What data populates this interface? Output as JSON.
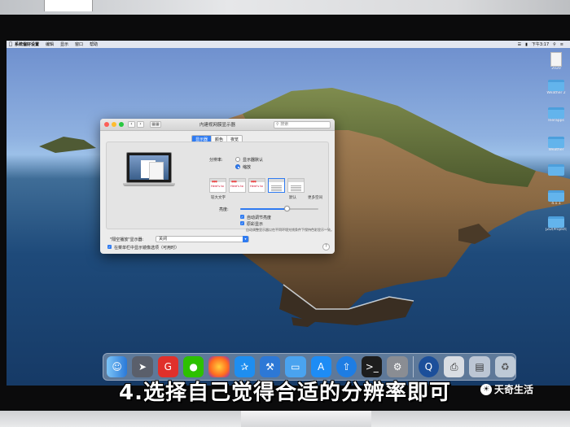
{
  "menubar": {
    "items": [
      "系统偏好设置",
      "编辑",
      "显示",
      "窗口",
      "帮助"
    ],
    "clock": "下午3:17"
  },
  "desktop_icons": [
    {
      "label": "2020"
    },
    {
      "label": "Weather 2"
    },
    {
      "label": "Inerapps"
    },
    {
      "label": "Weather"
    },
    {
      "label": ""
    },
    {
      "label": "4.1.1"
    },
    {
      "label": "JZD(Project)"
    }
  ],
  "window": {
    "title": "内建视网膜显示器",
    "search_placeholder": "搜索",
    "tabs": [
      {
        "label": "显示器",
        "active": true
      },
      {
        "label": "颜色",
        "active": false
      },
      {
        "label": "夜览",
        "active": false
      }
    ],
    "resolution_label": "分辨率:",
    "resolution_options": [
      {
        "label": "显示器默认",
        "selected": false
      },
      {
        "label": "缩放",
        "selected": true
      }
    ],
    "scaled_options": [
      {
        "label": "较大文字",
        "thumb_text": "Here's to",
        "selected": false
      },
      {
        "label": "",
        "thumb_text": "Here's to",
        "selected": false
      },
      {
        "label": "",
        "thumb_text": "Here's to",
        "selected": false
      },
      {
        "label": "默认",
        "thumb_text": "",
        "selected": true
      },
      {
        "label": "更多空间",
        "thumb_text": "",
        "selected": false
      }
    ],
    "brightness_label": "亮度:",
    "brightness_value": 0.6,
    "auto_brightness_label": "自动调节亮度",
    "true_tone_label": "原彩显示",
    "true_tone_note": "自动调整显示器以在不同环境光线条件下保持色彩显示一致。",
    "airplay_label": "\"隔空播放\"显示器:",
    "airplay_value": "关闭",
    "mirror_option_label": "在菜单栏中显示镜像选项（可用时）",
    "help_label": "?"
  },
  "dock": {
    "apps": [
      "finder-icon",
      "launchpad-icon",
      "app-g-icon",
      "wechat-icon",
      "firefox-icon",
      "safari-icon",
      "xcode-icon",
      "folder-icon",
      "app-store-icon",
      "upload-icon",
      "terminal-icon",
      "system-preferences-icon",
      "quicktime-icon",
      "printer-icon",
      "preview-icon",
      "trash-icon"
    ]
  },
  "caption": "4.选择自己觉得合适的分辨率即可",
  "watermark": "天奇生活",
  "colors": {
    "accent": "#2f7bf1",
    "caption_text": "#ffffff"
  }
}
